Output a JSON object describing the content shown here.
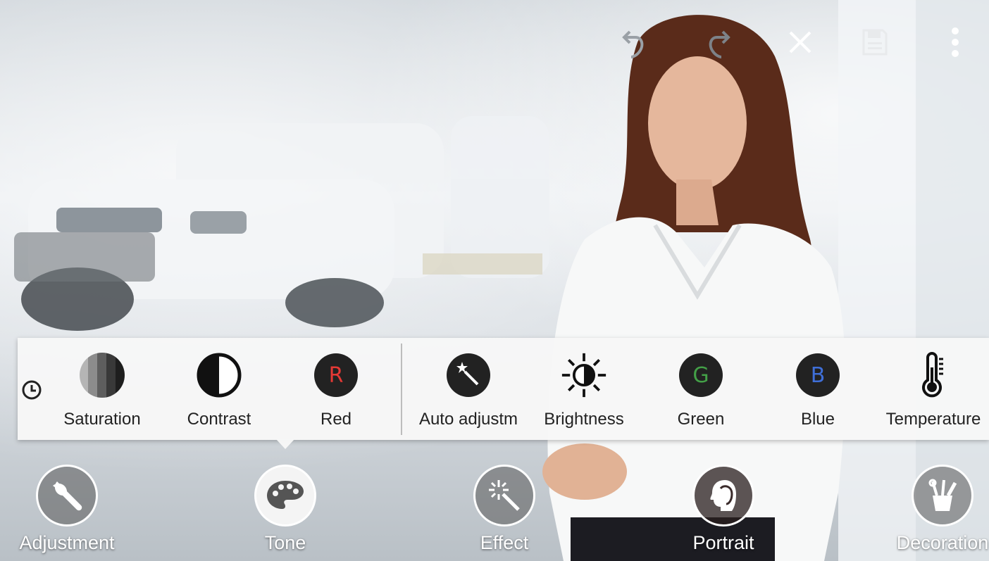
{
  "app": {
    "toolbar": {
      "undo_icon": "undo-icon",
      "redo_icon": "redo-icon",
      "close_icon": "close-icon",
      "save_icon": "save-icon",
      "more_icon": "more-vert-icon"
    },
    "tone_panel": {
      "history_icon": "clock-icon",
      "tools": [
        {
          "label": "Saturation",
          "icon": "saturation-icon"
        },
        {
          "label": "Contrast",
          "icon": "contrast-icon"
        },
        {
          "label": "Red",
          "icon": "red-channel-icon",
          "letter": "R",
          "color": "#e53935"
        },
        {
          "label": "Auto adjustm",
          "icon": "magic-wand-icon"
        },
        {
          "label": "Brightness",
          "icon": "brightness-icon"
        },
        {
          "label": "Green",
          "icon": "green-channel-icon",
          "letter": "G",
          "color": "#43a047"
        },
        {
          "label": "Blue",
          "icon": "blue-channel-icon",
          "letter": "B",
          "color": "#3f6fd8"
        },
        {
          "label": "Temperature",
          "icon": "thermometer-icon"
        }
      ]
    },
    "bottom_nav": [
      {
        "label": "Adjustment",
        "icon": "wrench-icon",
        "active": false
      },
      {
        "label": "Tone",
        "icon": "palette-icon",
        "active": true
      },
      {
        "label": "Effect",
        "icon": "magic-wand-icon",
        "active": false
      },
      {
        "label": "Portrait",
        "icon": "portrait-icon",
        "active": false
      },
      {
        "label": "Decoration",
        "icon": "decoration-icon",
        "active": false
      }
    ]
  }
}
